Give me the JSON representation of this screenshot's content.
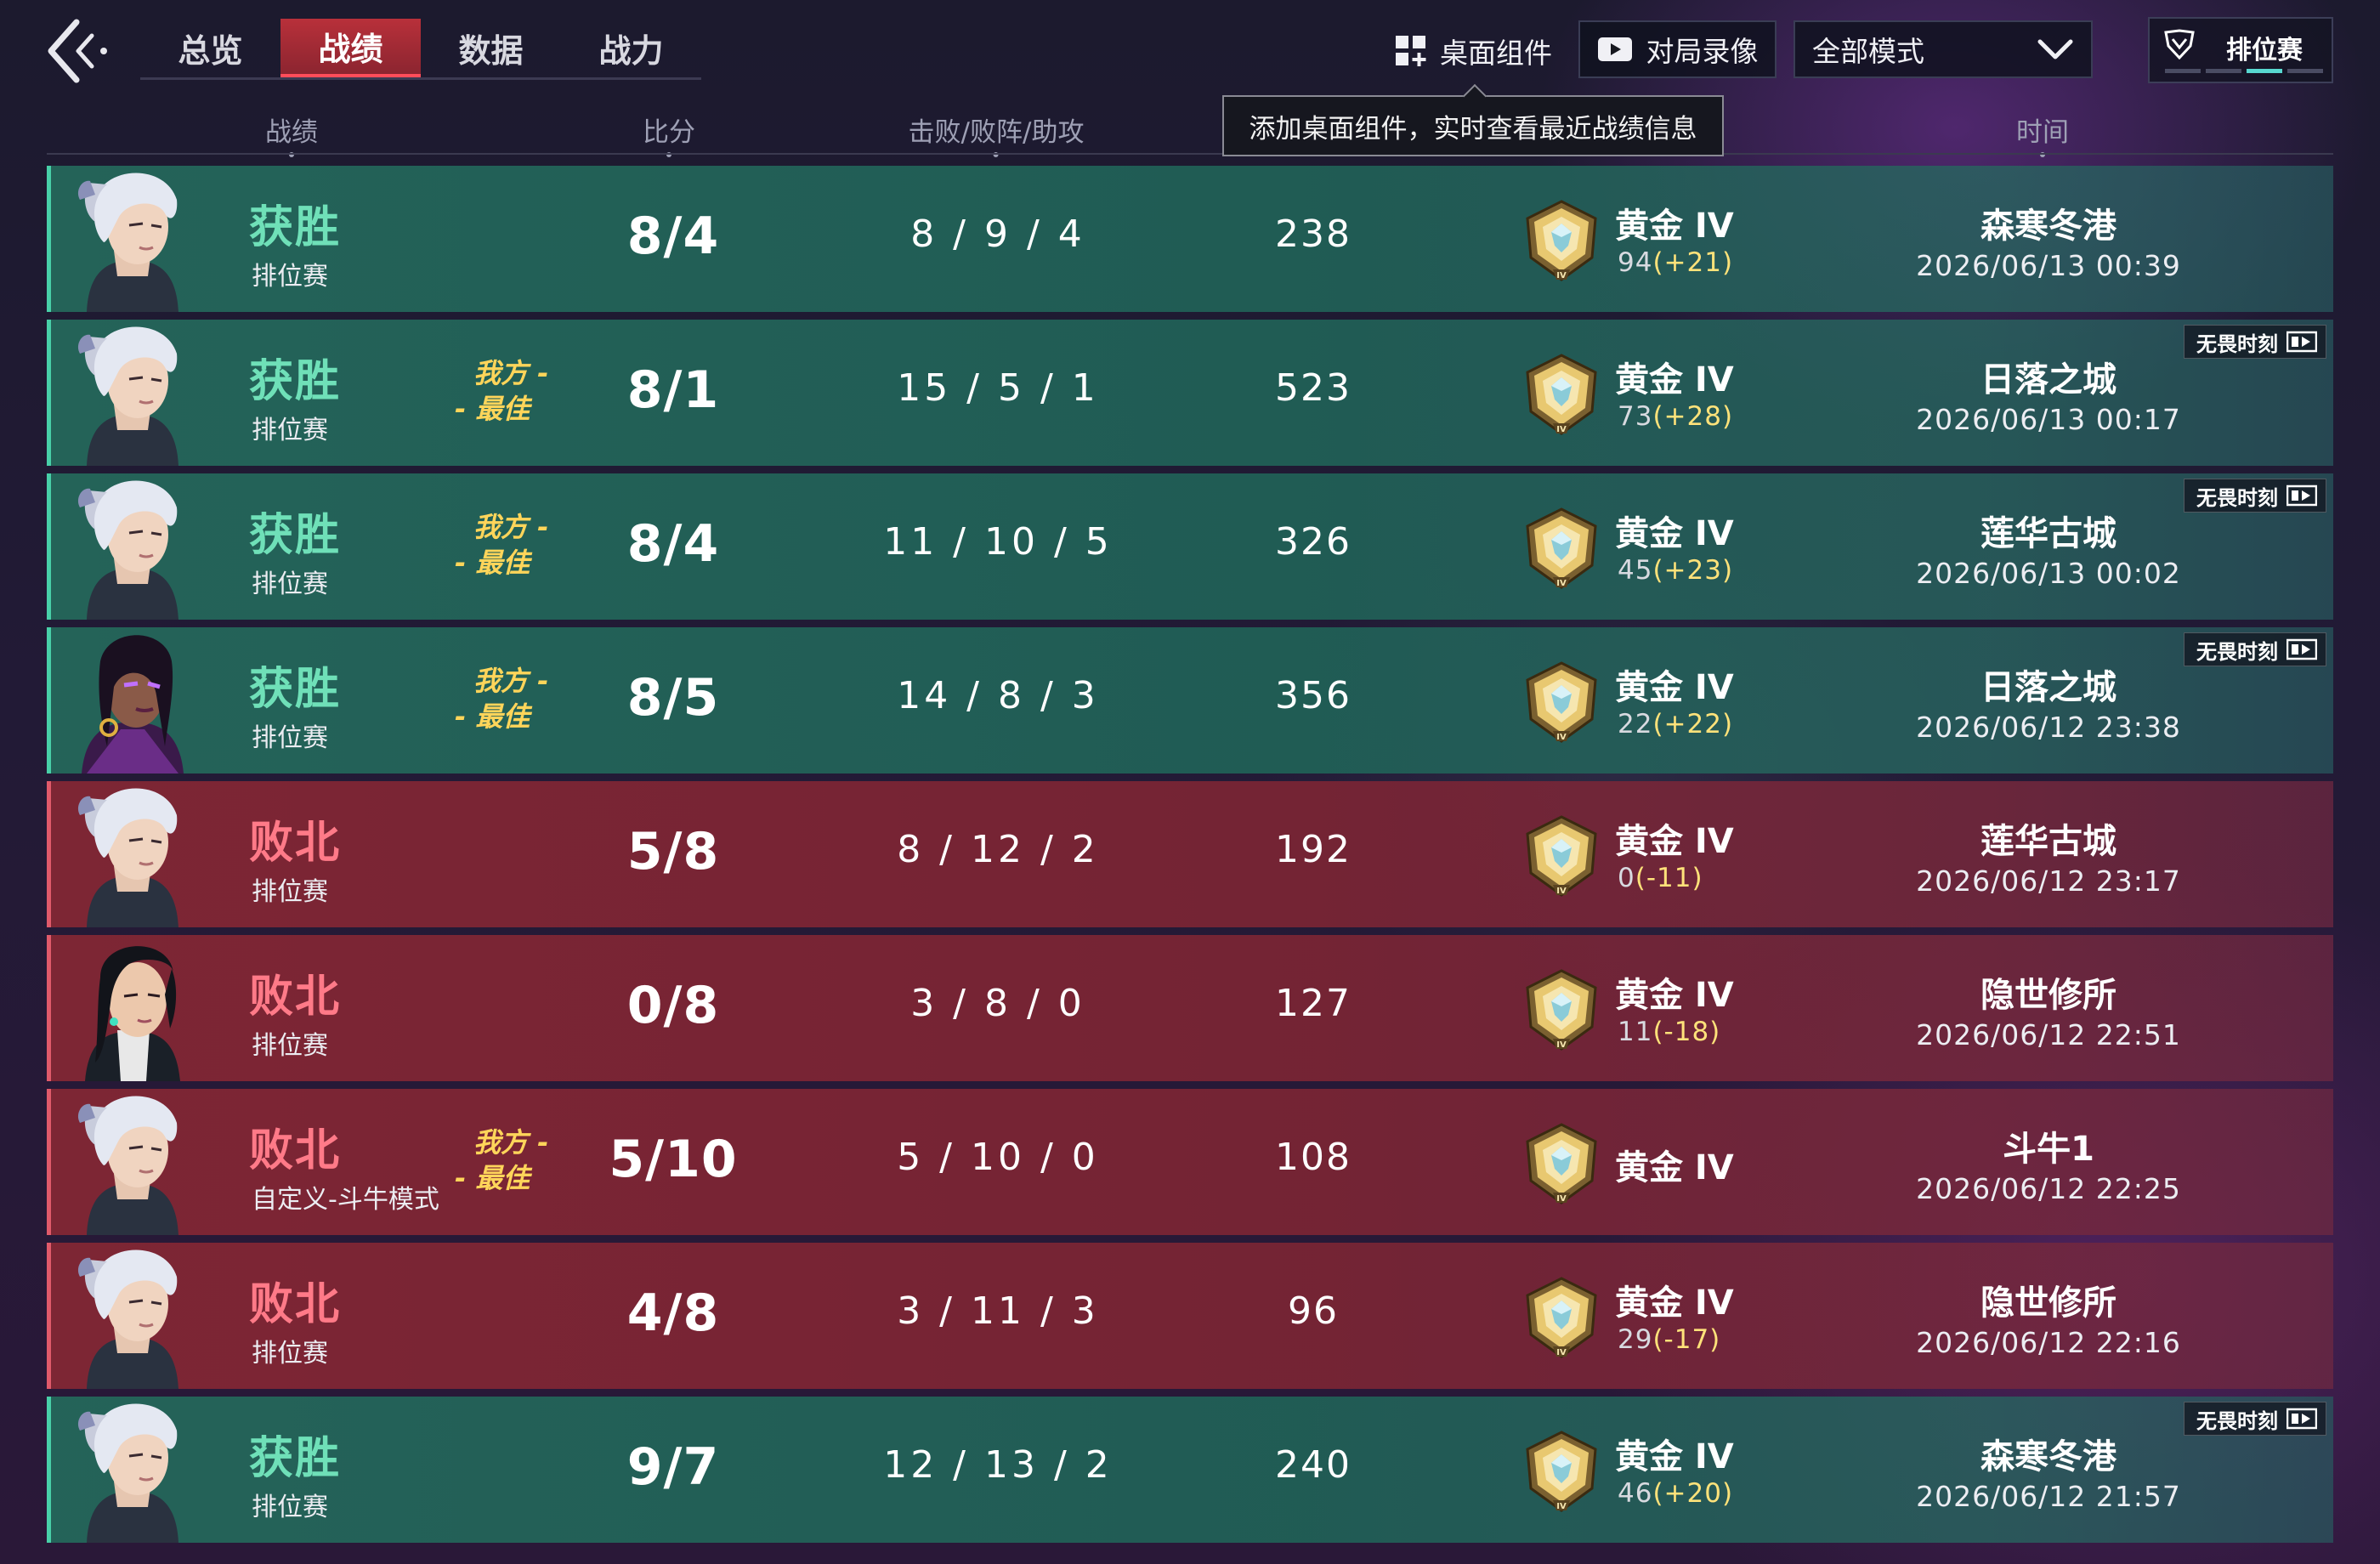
{
  "nav": {
    "tabs": [
      {
        "label": "总览",
        "active": false
      },
      {
        "label": "战绩",
        "active": true
      },
      {
        "label": "数据",
        "active": false
      },
      {
        "label": "战力",
        "active": false
      }
    ]
  },
  "toolbar": {
    "widget_label": "桌面组件",
    "replay_label": "对局录像",
    "mode_select_value": "全部模式",
    "rank_chip_label": "排位赛"
  },
  "tooltip": "添加桌面组件，实时查看最近战绩信息",
  "headers": {
    "record": "战绩",
    "score": "比分",
    "kda": "击败/败阵/助攻",
    "time": "时间"
  },
  "colors": {
    "win_accent": "#6fe0b8",
    "loss_accent": "#ff7a88",
    "mvp_gold": "#ffd55a",
    "active_tab": "#b8303a"
  },
  "matches": [
    {
      "result": "获胜",
      "queue": "排位赛",
      "agent": "jett",
      "mvp": false,
      "score": "8/4",
      "kda": "8 / 9 / 4",
      "acs": "238",
      "rank": "黄金 IV",
      "rr": "94",
      "rr_delta": "(+21)",
      "map": "森寒冬港",
      "time": "2026/06/13 00:39",
      "highlight": false
    },
    {
      "result": "获胜",
      "queue": "排位赛",
      "agent": "jett",
      "mvp": true,
      "score": "8/1",
      "kda": "15 / 5 / 1",
      "acs": "523",
      "rank": "黄金 IV",
      "rr": "73",
      "rr_delta": "(+28)",
      "map": "日落之城",
      "time": "2026/06/13 00:17",
      "highlight": true
    },
    {
      "result": "获胜",
      "queue": "排位赛",
      "agent": "jett",
      "mvp": true,
      "score": "8/4",
      "kda": "11 / 10 / 5",
      "acs": "326",
      "rank": "黄金 IV",
      "rr": "45",
      "rr_delta": "(+23)",
      "map": "莲华古城",
      "time": "2026/06/13 00:02",
      "highlight": true
    },
    {
      "result": "获胜",
      "queue": "排位赛",
      "agent": "reyna",
      "mvp": true,
      "score": "8/5",
      "kda": "14 / 8 / 3",
      "acs": "356",
      "rank": "黄金 IV",
      "rr": "22",
      "rr_delta": "(+22)",
      "map": "日落之城",
      "time": "2026/06/12 23:38",
      "highlight": true
    },
    {
      "result": "败北",
      "queue": "排位赛",
      "agent": "jett",
      "mvp": false,
      "score": "5/8",
      "kda": "8 / 12 / 2",
      "acs": "192",
      "rank": "黄金 IV",
      "rr": "0",
      "rr_delta": "(-11)",
      "map": "莲华古城",
      "time": "2026/06/12 23:17",
      "highlight": false
    },
    {
      "result": "败北",
      "queue": "排位赛",
      "agent": "sage",
      "mvp": false,
      "score": "0/8",
      "kda": "3 / 8 / 0",
      "acs": "127",
      "rank": "黄金 IV",
      "rr": "11",
      "rr_delta": "(-18)",
      "map": "隐世修所",
      "time": "2026/06/12 22:51",
      "highlight": false
    },
    {
      "result": "败北",
      "queue": "自定义-斗牛模式",
      "agent": "jett",
      "mvp": true,
      "score": "5/10",
      "kda": "5 / 10 / 0",
      "acs": "108",
      "rank": "黄金 IV",
      "rr": "",
      "rr_delta": "",
      "map": "斗牛1",
      "time": "2026/06/12 22:25",
      "highlight": false
    },
    {
      "result": "败北",
      "queue": "排位赛",
      "agent": "jett",
      "mvp": false,
      "score": "4/8",
      "kda": "3 / 11 / 3",
      "acs": "96",
      "rank": "黄金 IV",
      "rr": "29",
      "rr_delta": "(-17)",
      "map": "隐世修所",
      "time": "2026/06/12 22:16",
      "highlight": false
    },
    {
      "result": "获胜",
      "queue": "排位赛",
      "agent": "jett",
      "mvp": false,
      "score": "9/7",
      "kda": "12 / 13 / 2",
      "acs": "240",
      "rank": "黄金 IV",
      "rr": "46",
      "rr_delta": "(+20)",
      "map": "森寒冬港",
      "time": "2026/06/12 21:57",
      "highlight": true
    }
  ],
  "labels": {
    "mvp_line1": "我方 -",
    "mvp_line2": "- 最佳",
    "highlight_tag": "无畏时刻"
  }
}
